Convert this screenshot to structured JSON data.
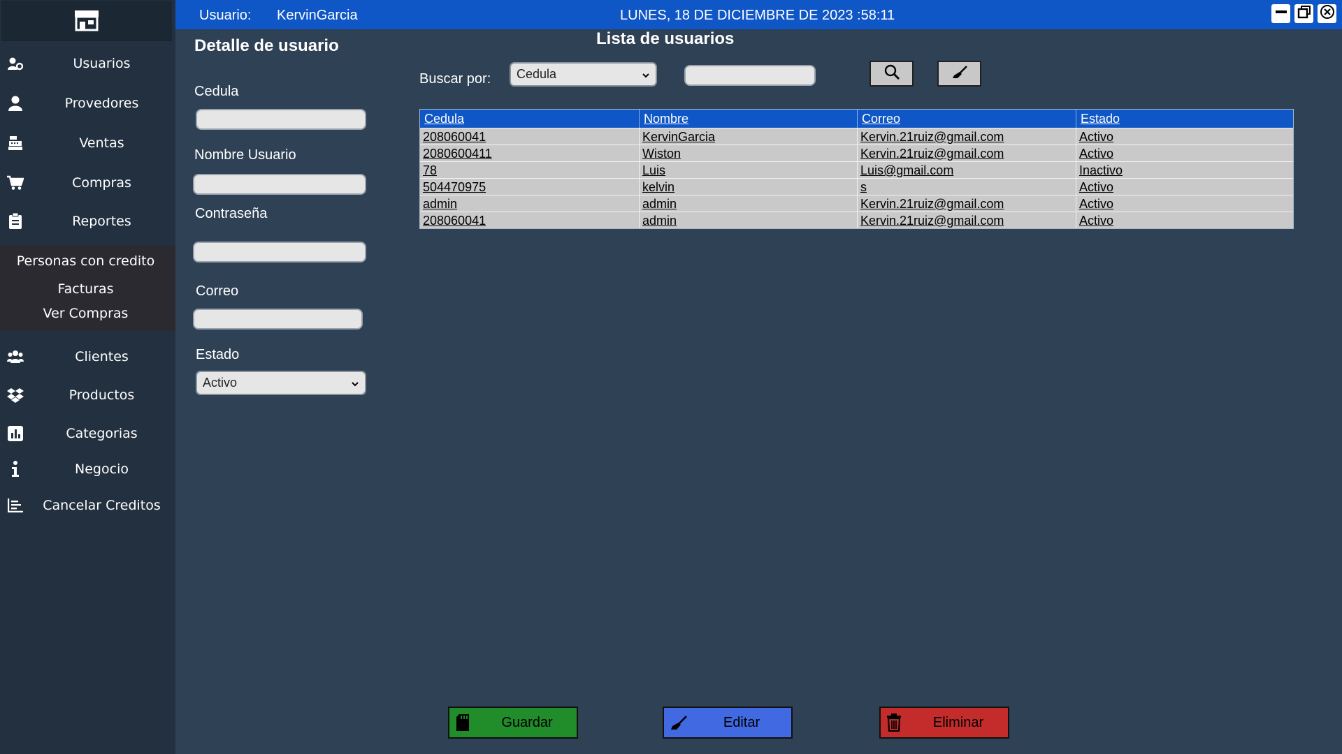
{
  "sidebar": {
    "items": [
      {
        "label": "Usuarios",
        "icon": "users-gear-icon"
      },
      {
        "label": "Provedores",
        "icon": "user-icon"
      },
      {
        "label": "Ventas",
        "icon": "cash-register-icon"
      },
      {
        "label": "Compras",
        "icon": "cart-icon"
      },
      {
        "label": "Reportes",
        "icon": "clipboard-icon"
      },
      {
        "label": "Clientes",
        "icon": "users-icon"
      },
      {
        "label": "Productos",
        "icon": "dropbox-icon"
      },
      {
        "label": "Categorias",
        "icon": "bar-chart-icon"
      },
      {
        "label": "Negocio",
        "icon": "info-icon"
      },
      {
        "label": "Cancelar Creditos",
        "icon": "list-chart-icon"
      }
    ],
    "submenu": [
      "Personas con credito",
      "Facturas",
      "Ver Compras"
    ]
  },
  "topbar": {
    "user_label": "Usuario:",
    "user_name": "KervinGarcia",
    "datetime": "LUNES, 18 DE DICIEMBRE DE 2023 :58:11"
  },
  "form": {
    "title": "Detalle de usuario",
    "cedula_label": "Cedula",
    "nombre_label": "Nombre Usuario",
    "password_label": "Contraseña",
    "correo_label": "Correo",
    "estado_label": "Estado",
    "estado_value": "Activo"
  },
  "list": {
    "title": "Lista de usuarios",
    "search_label": "Buscar por:",
    "search_by_value": "Cedula",
    "columns": [
      "Cedula",
      "Nombre",
      "Correo",
      "Estado"
    ],
    "rows": [
      [
        "208060041",
        "KervinGarcia",
        "Kervin.21ruiz@gmail.com",
        "Activo"
      ],
      [
        "2080600411",
        "Wiston",
        "Kervin.21ruiz@gmail.com",
        "Activo"
      ],
      [
        "78",
        "Luis",
        "Luis@gmail.com",
        "Inactivo"
      ],
      [
        "504470975",
        "kelvin",
        "s",
        "Activo"
      ],
      [
        "admin",
        "admin",
        "Kervin.21ruiz@gmail.com",
        "Activo"
      ],
      [
        "208060041",
        "admin",
        "Kervin.21ruiz@gmail.com",
        "Activo"
      ]
    ]
  },
  "actions": {
    "save": "Guardar",
    "edit": "Editar",
    "delete": "Eliminar"
  },
  "colors": {
    "sidebar": "#22303f",
    "content": "#2e4155",
    "accent": "#0f56c6",
    "save": "#218c2a",
    "edit": "#4169e1",
    "delete": "#c42b2b"
  }
}
